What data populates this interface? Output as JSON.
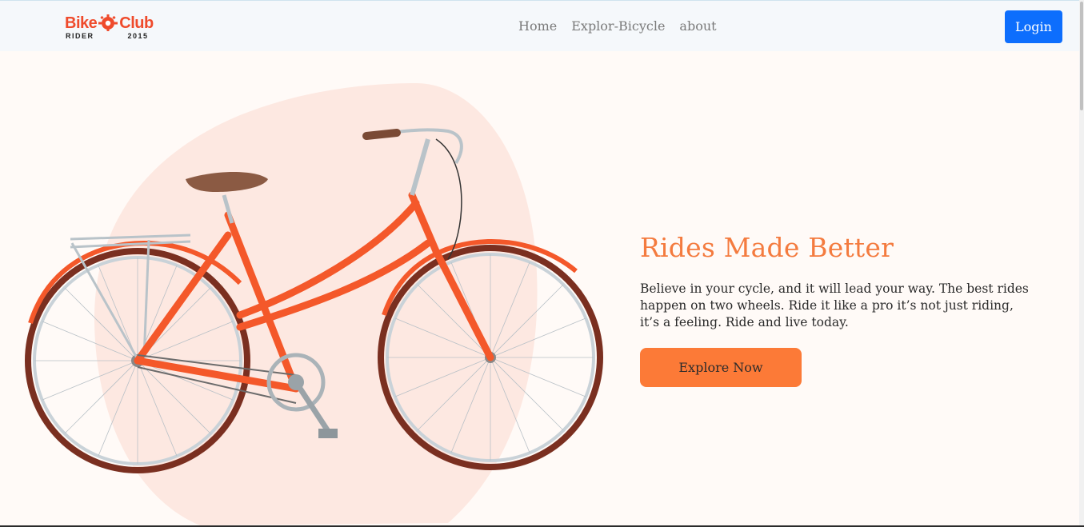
{
  "navbar": {
    "logo": {
      "top_word_left": "Bike",
      "top_word_right": "Club",
      "bottom_left": "RIDER",
      "bottom_right": "2015"
    },
    "links": [
      "Home",
      "Explor-Bicycle",
      "about"
    ],
    "login_label": "Login"
  },
  "hero": {
    "title": "Rides Made Better",
    "description": "Believe in your cycle, and it will lead your way. The best rides happen on two wheels. Ride it like a pro it’s not just riding, it’s a feeling. Ride and live today.",
    "cta_label": "Explore Now"
  },
  "colors": {
    "accent": "#fc7a37",
    "title": "#f47b3f",
    "login": "#0d6efd",
    "blob": "#fde8e1",
    "bike_frame": "#f4582a"
  }
}
